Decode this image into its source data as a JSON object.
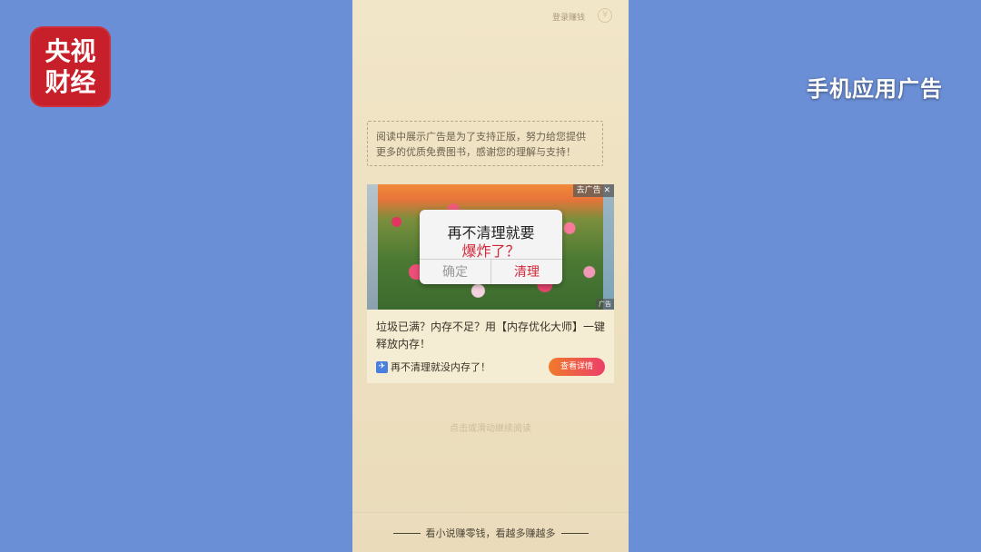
{
  "brand": {
    "line1": "央视",
    "line2": "财经"
  },
  "caption": "手机应用广告",
  "phone": {
    "top_link": "登录赚钱",
    "notice": "阅读中展示广告是为了支持正版，努力给您提供更多的优质免费图书，感谢您的理解与支持！",
    "ad": {
      "remove_label": "去广告 ✕",
      "corner_label": "广告",
      "dialog": {
        "line1": "再不清理就要",
        "line2": "爆炸了？",
        "confirm": "确定",
        "clean": "清理"
      },
      "text": "垃圾已满？内存不足？用【内存优化大师】一键释放内存！",
      "source": "再不清理就没内存了！",
      "details_button": "查看详情"
    },
    "continue_hint": "点击或滑动继续阅读",
    "footer": "看小说赚零钱，看越多赚越多"
  }
}
